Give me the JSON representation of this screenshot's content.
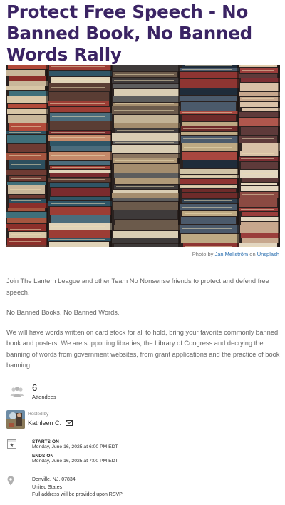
{
  "event": {
    "title": "Protect Free Speech - No Banned Book, No Banned Words Rally"
  },
  "photo_credit": {
    "prefix": "Photo by",
    "author": "Jan Mellström",
    "middle": "on",
    "source": "Unsplash"
  },
  "description": [
    "Join The Lantern League and other Team No Nonsense friends to protect and defend free speech.",
    "No Banned Books, No Banned Words.",
    "We will have words written on card stock for all to hold, bring your favorite commonly banned book and posters.  We are supporting libraries, the Library of Congress and decrying the banning of words from government websites, from grant applications and the practice of book banning!"
  ],
  "attendees": {
    "count": "6",
    "label": "Attendees",
    "icon": "people-icon"
  },
  "host": {
    "hosted_by_label": "Hosted by",
    "name": "Kathleen C.",
    "icon": "mail-icon"
  },
  "schedule": {
    "starts_label": "STARTS ON",
    "starts_value": "Monday, June 16, 2025 at 6:00 PM EDT",
    "ends_label": "ENDS ON",
    "ends_value": "Monday, June 16, 2025 at 7:00 PM EDT",
    "icon": "calendar-icon"
  },
  "location": {
    "line1": "Denville, NJ, 07834",
    "line2": "United States",
    "line3": "Full address will be provided upon RSVP",
    "icon": "map-pin-icon"
  },
  "colors": {
    "title": "#3b2464",
    "link": "#2a6fb0",
    "text": "#666666"
  }
}
